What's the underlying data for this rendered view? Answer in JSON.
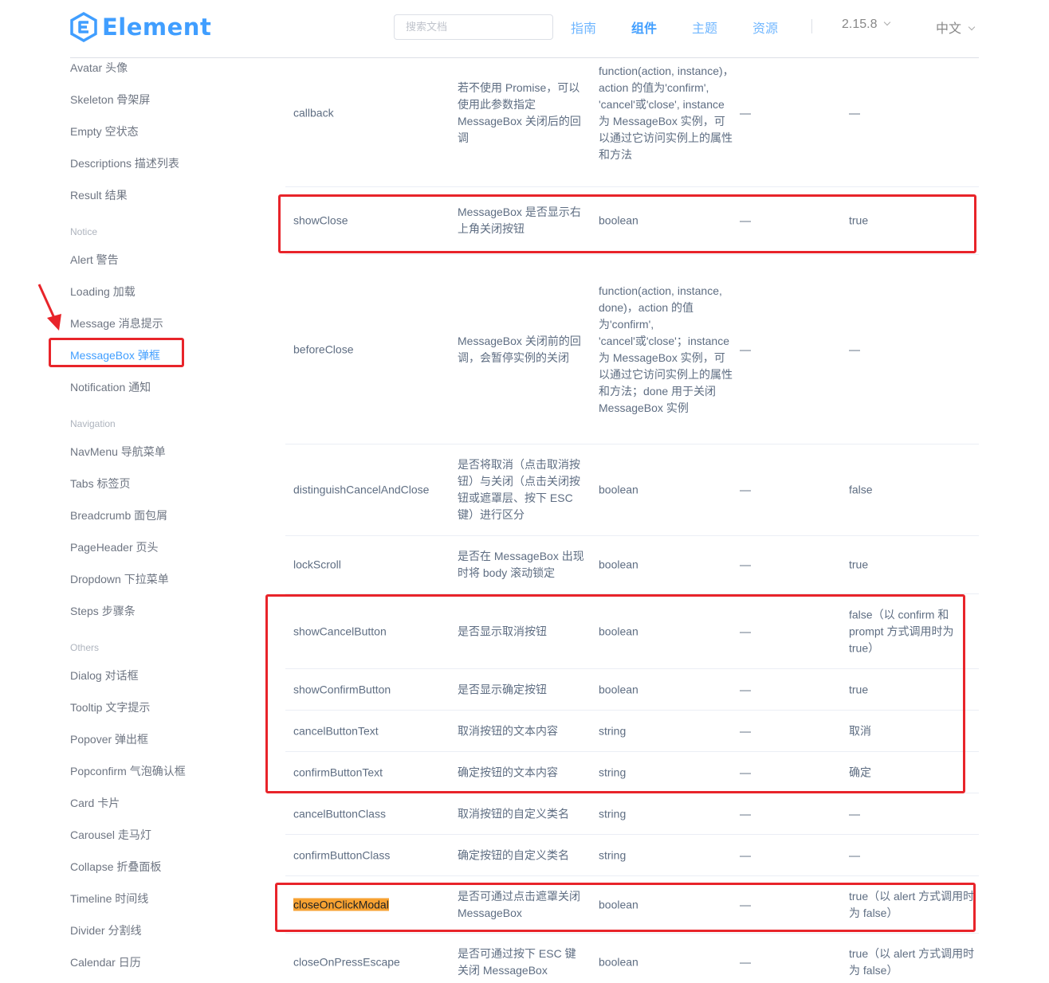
{
  "header": {
    "logo_text": "Element",
    "search_placeholder": "搜索文档",
    "nav": [
      "指南",
      "组件",
      "主题",
      "资源"
    ],
    "active_nav": "组件",
    "version": "2.15.8",
    "language": "中文"
  },
  "sidebar": {
    "items": [
      {
        "label": "Avatar 头像",
        "type": "item"
      },
      {
        "label": "Skeleton 骨架屏",
        "type": "item"
      },
      {
        "label": "Empty 空状态",
        "type": "item"
      },
      {
        "label": "Descriptions 描述列表",
        "type": "item"
      },
      {
        "label": "Result 结果",
        "type": "item"
      },
      {
        "label": "Notice",
        "type": "group"
      },
      {
        "label": "Alert 警告",
        "type": "item"
      },
      {
        "label": "Loading 加载",
        "type": "item"
      },
      {
        "label": "Message 消息提示",
        "type": "item"
      },
      {
        "label": "MessageBox 弹框",
        "type": "item",
        "active": true
      },
      {
        "label": "Notification 通知",
        "type": "item"
      },
      {
        "label": "Navigation",
        "type": "group"
      },
      {
        "label": "NavMenu 导航菜单",
        "type": "item"
      },
      {
        "label": "Tabs 标签页",
        "type": "item"
      },
      {
        "label": "Breadcrumb 面包屑",
        "type": "item"
      },
      {
        "label": "PageHeader 页头",
        "type": "item"
      },
      {
        "label": "Dropdown 下拉菜单",
        "type": "item"
      },
      {
        "label": "Steps 步骤条",
        "type": "item"
      },
      {
        "label": "Others",
        "type": "group"
      },
      {
        "label": "Dialog 对话框",
        "type": "item"
      },
      {
        "label": "Tooltip 文字提示",
        "type": "item"
      },
      {
        "label": "Popover 弹出框",
        "type": "item"
      },
      {
        "label": "Popconfirm 气泡确认框",
        "type": "item"
      },
      {
        "label": "Card 卡片",
        "type": "item"
      },
      {
        "label": "Carousel 走马灯",
        "type": "item"
      },
      {
        "label": "Collapse 折叠面板",
        "type": "item"
      },
      {
        "label": "Timeline 时间线",
        "type": "item"
      },
      {
        "label": "Divider 分割线",
        "type": "item"
      },
      {
        "label": "Calendar 日历",
        "type": "item"
      }
    ]
  },
  "table": {
    "rows": [
      {
        "param": "callback",
        "desc": "若不使用 Promise，可以使用此参数指定 MessageBox 关闭后的回调",
        "type": "function(action, instance)，action 的值为'confirm', 'cancel'或'close', instance 为 MessageBox 实例，可以通过它访问实例上的属性和方法",
        "options": "—",
        "default": "—"
      },
      {
        "param": "showClose",
        "desc": "MessageBox 是否显示右上角关闭按钮",
        "type": "boolean",
        "options": "—",
        "default": "true"
      },
      {
        "param": "beforeClose",
        "desc": "MessageBox 关闭前的回调，会暂停实例的关闭",
        "type": "function(action, instance, done)，action 的值为'confirm', 'cancel'或'close'；instance 为 MessageBox 实例，可以通过它访问实例上的属性和方法；done 用于关闭 MessageBox 实例",
        "options": "—",
        "default": "—"
      },
      {
        "param": "distinguishCancelAndClose",
        "desc": "是否将取消（点击取消按钮）与关闭（点击关闭按钮或遮罩层、按下 ESC 键）进行区分",
        "type": "boolean",
        "options": "—",
        "default": "false"
      },
      {
        "param": "lockScroll",
        "desc": "是否在 MessageBox 出现时将 body 滚动锁定",
        "type": "boolean",
        "options": "—",
        "default": "true"
      },
      {
        "param": "showCancelButton",
        "desc": "是否显示取消按钮",
        "type": "boolean",
        "options": "—",
        "default": "false（以 confirm 和 prompt 方式调用时为 true）"
      },
      {
        "param": "showConfirmButton",
        "desc": "是否显示确定按钮",
        "type": "boolean",
        "options": "—",
        "default": "true"
      },
      {
        "param": "cancelButtonText",
        "desc": "取消按钮的文本内容",
        "type": "string",
        "options": "—",
        "default": "取消"
      },
      {
        "param": "confirmButtonText",
        "desc": "确定按钮的文本内容",
        "type": "string",
        "options": "—",
        "default": "确定"
      },
      {
        "param": "cancelButtonClass",
        "desc": "取消按钮的自定义类名",
        "type": "string",
        "options": "—",
        "default": "—"
      },
      {
        "param": "confirmButtonClass",
        "desc": "确定按钮的自定义类名",
        "type": "string",
        "options": "—",
        "default": "—"
      },
      {
        "param": "closeOnClickModal",
        "desc": "是否可通过点击遮罩关闭 MessageBox",
        "type": "boolean",
        "options": "—",
        "default": "true（以 alert 方式调用时为 false）",
        "highlight": true
      },
      {
        "param": "closeOnPressEscape",
        "desc": "是否可通过按下 ESC 键关闭 MessageBox",
        "type": "boolean",
        "options": "—",
        "default": "true（以 alert 方式调用时为 false）"
      }
    ]
  },
  "colors": {
    "brand": "#409eff",
    "annotation": "#e8242a",
    "highlight": "#f7a232"
  }
}
